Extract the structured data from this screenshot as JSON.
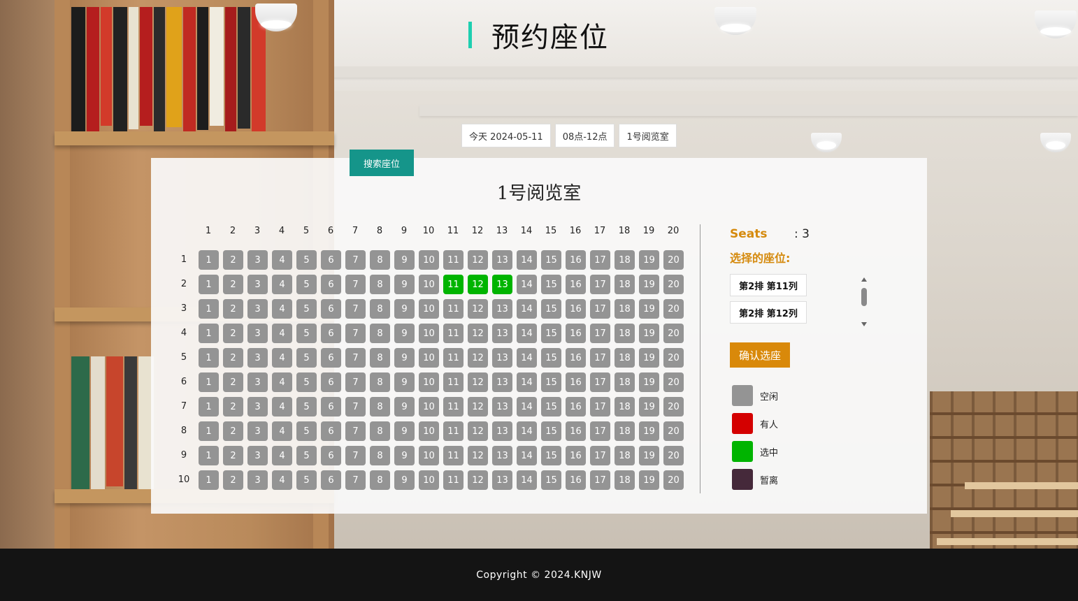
{
  "page": {
    "title": "预约座位"
  },
  "filters": {
    "date": "今天 2024-05-11",
    "time": "08点-12点",
    "room": "1号阅览室"
  },
  "search_button": "搜索座位",
  "room_title": "1号阅览室",
  "seat_map": {
    "rows": 10,
    "cols": 20,
    "selected": [
      [
        2,
        11
      ],
      [
        2,
        12
      ],
      [
        2,
        13
      ]
    ],
    "occupied": [],
    "away": []
  },
  "side": {
    "seats_label": "Seats",
    "seats_count": ": 3",
    "chosen_title": "选择的座位:",
    "chosen": [
      "第2排 第11列",
      "第2排 第12列"
    ],
    "confirm": "确认选座"
  },
  "legend": [
    {
      "label": "空闲",
      "color": "#949494"
    },
    {
      "label": "有人",
      "color": "#d40000"
    },
    {
      "label": "选中",
      "color": "#00b400"
    },
    {
      "label": "暂离",
      "color": "#45293a"
    }
  ],
  "footer": "Copyright © 2024.KNJW",
  "colors": {
    "accent": "#1ecfb0",
    "primary": "#15958a",
    "orange": "#d9890a"
  }
}
